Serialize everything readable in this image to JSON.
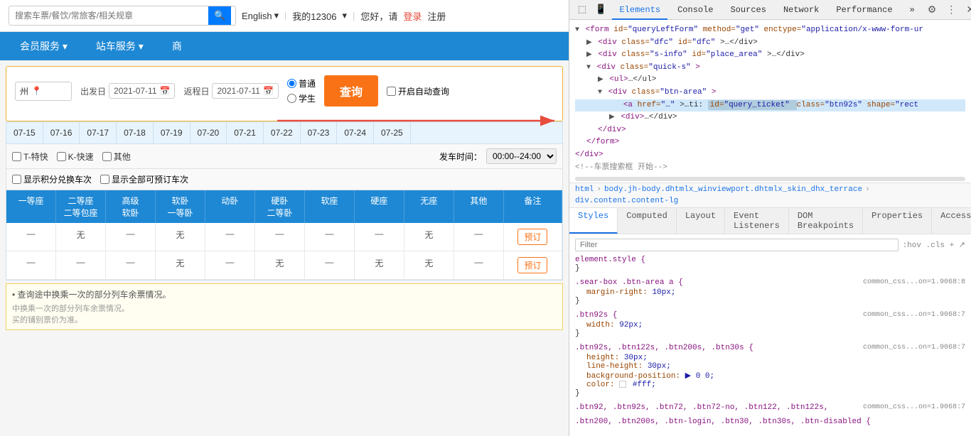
{
  "header": {
    "search_placeholder": "搜索车票/餐饮/常旅客/相关规章",
    "lang_label": "English",
    "user_greeting": "您好，请",
    "login_label": "登录",
    "register_label": "注册",
    "account_label": "我的12306"
  },
  "nav": {
    "items": [
      {
        "label": "会员服务 ▾"
      },
      {
        "label": "站车服务 ▾"
      },
      {
        "label": "商"
      }
    ]
  },
  "search_form": {
    "from_label": "州",
    "departure_label": "出发日",
    "departure_date": "2021-07-11",
    "return_label": "返程日",
    "return_date": "2021-07-11",
    "train_type_normal": "普通",
    "train_type_student": "学生",
    "query_btn": "查询",
    "auto_query": "开启自动查询"
  },
  "date_tabs": [
    "07-15",
    "07-16",
    "07-17",
    "07-18",
    "07-19",
    "07-20",
    "07-21",
    "07-22",
    "07-23",
    "07-24",
    "07-25"
  ],
  "filters": {
    "t_fast": "T-特快",
    "k_fast": "K-快速",
    "other": "其他",
    "depart_time": "发车时间：",
    "time_range": "00:00--24:00"
  },
  "display_options": {
    "show_integral": "显示积分兑换车次",
    "show_all": "显示全部可预订车次"
  },
  "table": {
    "headers": [
      "一等座",
      "二等座\n二等包座",
      "高级\n软卧",
      "软卧\n一等卧",
      "动卧",
      "硬卧\n二等卧",
      "软座",
      "硬座",
      "无座",
      "其他",
      "备注"
    ],
    "rows": [
      {
        "cells": [
          "—",
          "无",
          "—",
          "无",
          "—",
          "—",
          "—",
          "—",
          "无",
          "—"
        ],
        "note": "预订"
      },
      {
        "cells": [
          "—",
          "—",
          "—",
          "无",
          "—",
          "无",
          "—",
          "无",
          "无",
          "—"
        ],
        "note": "预订"
      }
    ]
  },
  "notes": [
    "查询途中换乘一次的部分列车余票情况。",
    "中换乘一次的部分列车余票情况。",
    "买的铺别票价为准。"
  ],
  "devtools": {
    "tabs": [
      "Elements",
      "Console",
      "Sources",
      "Network",
      "Performance"
    ],
    "active_tab": "Elements",
    "more_tabs_label": "»",
    "html_tree": [
      {
        "indent": 0,
        "text": "▼ <form id=\"queryLeftForm\" method=\"get\" enctype=\"application/x-www-form-ur"
      },
      {
        "indent": 1,
        "text": "▶ <div class=\"dfc\" id=\"dfc\">…</div>"
      },
      {
        "indent": 1,
        "text": "▶ <div class=\"s-info\" id=\"place_area\">…</div>"
      },
      {
        "indent": 1,
        "text": "▼ <div class=\"quick-s\">"
      },
      {
        "indent": 2,
        "text": "▶ <ul>…</ul>"
      },
      {
        "indent": 2,
        "text": "▼ <div class=\"btn-area\">"
      },
      {
        "indent": 3,
        "text": "  <a href=\"…\">…ti: id=\"query_ticket\" class=\"btn92s\" shape=\"rect"
      },
      {
        "indent": 3,
        "text": "▶ <div>…</div>"
      },
      {
        "indent": 2,
        "text": "</div>"
      },
      {
        "indent": 1,
        "text": "</form>"
      },
      {
        "indent": 0,
        "text": "</div>"
      },
      {
        "indent": 0,
        "text": "<!--车票搜索框 开始-->"
      }
    ],
    "breadcrumb": [
      "html",
      "body.jh-body.dhtmlx_winviewport.dhtmlx_skin_dhx_terrace",
      "div.content.content-lg"
    ],
    "sub_tabs": [
      "Styles",
      "Computed",
      "Layout",
      "Event Listeners",
      "DOM Breakpoints",
      "Properties",
      "Accessibility"
    ],
    "active_sub_tab": "Styles",
    "filter_hint": ":hov .cls + ↗",
    "css_rules": [
      {
        "selector": "element.style {",
        "properties": [],
        "source": ""
      },
      {
        "selector": ".sear-box .btn-area a {",
        "properties": [
          {
            "prop": "margin-right:",
            "val": " 10px;"
          }
        ],
        "source": "common_css...on=1.9068:8"
      },
      {
        "selector": ".btn92s {",
        "properties": [
          {
            "prop": "width:",
            "val": " 92px;"
          }
        ],
        "source": "common_css...on=1.9068:7"
      },
      {
        "selector": ".btn92s, .btn122s, .btn200s, .btn30s {",
        "properties": [
          {
            "prop": "height:",
            "val": " 30px;"
          },
          {
            "prop": "line-height:",
            "val": " 30px;"
          },
          {
            "prop": "background-position:",
            "val": " ▶ 0 0;"
          },
          {
            "prop": "color:",
            "val": " □#fff;"
          }
        ],
        "source": "common_css...on=1.9068:7"
      },
      {
        "selector": ".btn92, .btn92s, .btn72, .btn72-no, .btn122, .btn122s,",
        "properties": [],
        "source": "common_css...on=1.9068:7"
      },
      {
        "selector": ".btn200, .btn200s, .btn-login, .btn30, .btn30s, .btn-disabled {",
        "properties": [],
        "source": ""
      }
    ]
  }
}
